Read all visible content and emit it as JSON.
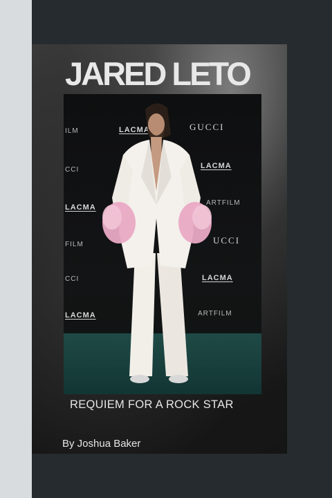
{
  "cover": {
    "title": "JARED LETO",
    "subtitle": "REQUIEM FOR A ROCK STAR",
    "author": "By Joshua Baker"
  },
  "backdrop": {
    "gucci": "GUCCI",
    "lacma": "LACMA",
    "art_film": "ARTFILM",
    "ilm": "ILM",
    "cci": "CCI",
    "ucci": "UCCI",
    "film": "FILM"
  },
  "colors": {
    "background": "#252b2e",
    "left_strip": "#d9dcdf",
    "title": "#e8e8e8",
    "carpet": "#1f4a46",
    "suit": "#f2efe9",
    "feathers": "#e9a9c4"
  }
}
